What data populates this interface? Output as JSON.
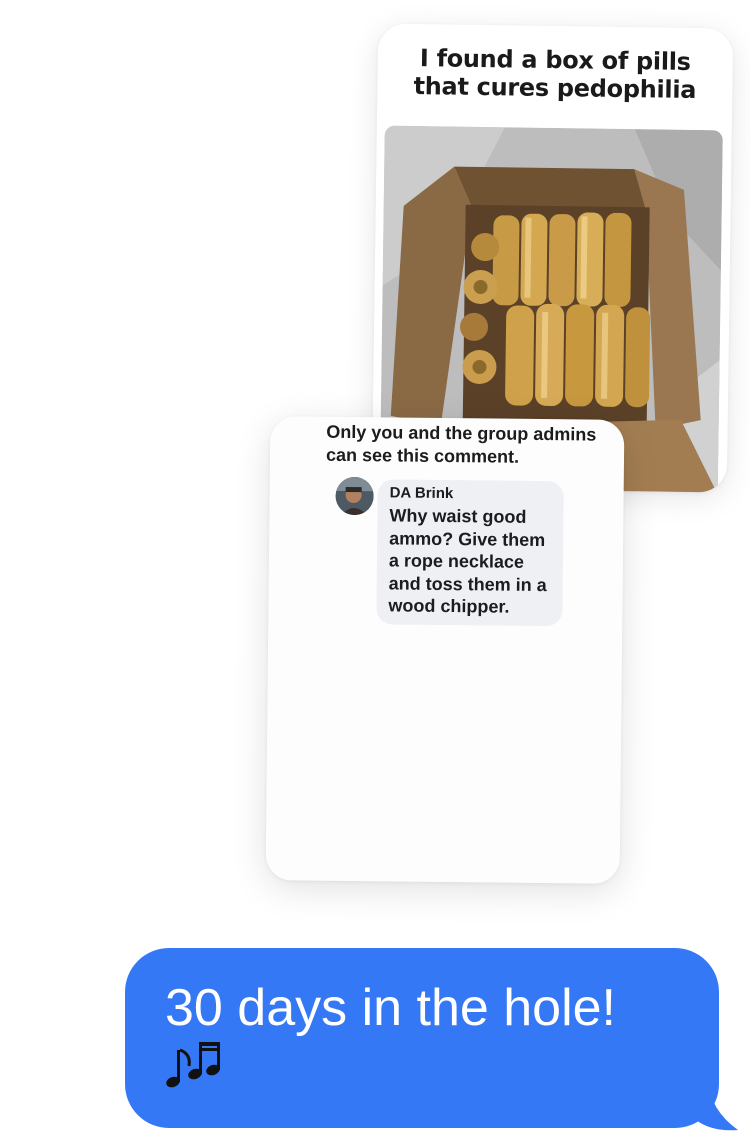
{
  "meme": {
    "caption": "I found a box of pills\nthat cures pedophilia",
    "image_subject": "box-of-bullets"
  },
  "comment_screenshot": {
    "privacy_note": "Only you and the group admins\ncan see this comment.",
    "author": "DA Brink",
    "text": "Why waist good\nammo? Give them\na rope necklace\nand toss them in a\nwood chipper."
  },
  "message": {
    "text": "30 days in the hole!",
    "emoji": "musical-notes-icon",
    "bubble_color": "#3478f6"
  }
}
